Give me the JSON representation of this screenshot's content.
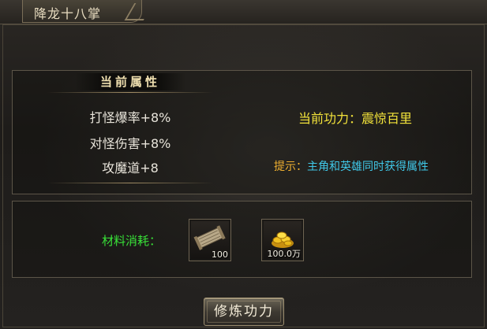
{
  "window": {
    "title": "降龙十八掌"
  },
  "attributes": {
    "header": "当前属性",
    "lines": [
      "打怪爆率+8%",
      "对怪伤害+8%",
      "攻魔道+8"
    ]
  },
  "skill": {
    "current": "当前功力：震惊百里"
  },
  "tip": {
    "label": "提示：",
    "text": "主角和英雄同时获得属性"
  },
  "materials": {
    "label": "材料消耗：",
    "items": [
      {
        "icon": "scroll-icon",
        "count": "100"
      },
      {
        "icon": "gold-coins-icon",
        "count": "100.0万"
      }
    ]
  },
  "actions": {
    "train_label": "修炼功力"
  },
  "colors": {
    "skill_text": "#f2e23a",
    "tip_label": "#f0b030",
    "tip_text": "#40c8e8",
    "material_label": "#38e038"
  }
}
